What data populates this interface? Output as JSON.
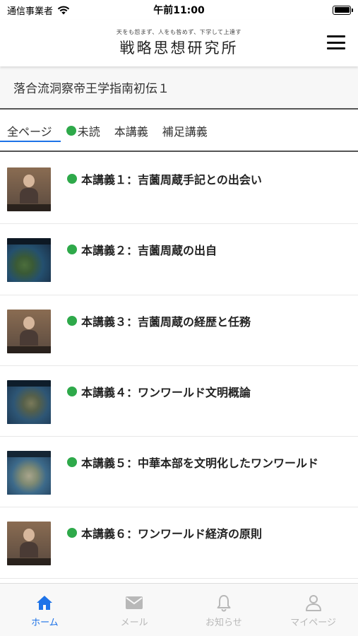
{
  "status_bar": {
    "carrier": "通信事業者",
    "time": "午前11:00"
  },
  "header": {
    "logo_tagline": "天をも怨まず、人をも咎めず、下学して上達す",
    "logo_title": "戦略思想研究所"
  },
  "course": {
    "title": "落合流洞察帝王学指南初伝１"
  },
  "tabs": [
    {
      "label": "全ページ",
      "active": true
    },
    {
      "label": "未読",
      "has_dot": true
    },
    {
      "label": "本講義"
    },
    {
      "label": "補足講義"
    }
  ],
  "lectures": [
    {
      "title": "本講義１：吉薗周蔵手記との出会い",
      "unread": true,
      "thumb": "speaker"
    },
    {
      "title": "本講義２：吉薗周蔵の出自",
      "unread": true,
      "thumb": "map"
    },
    {
      "title": "本講義３：吉薗周蔵の経歴と任務",
      "unread": true,
      "thumb": "speaker"
    },
    {
      "title": "本講義４：ワンワールド文明概論",
      "unread": true,
      "thumb": "map"
    },
    {
      "title": "本講義５：中華本部を文明化したワンワールド",
      "unread": true,
      "thumb": "map"
    },
    {
      "title": "本講義６：ワンワールド経済の原則",
      "unread": true,
      "thumb": "speaker"
    }
  ],
  "tab_bar": [
    {
      "label": "ホーム",
      "icon": "home-icon",
      "active": true
    },
    {
      "label": "メール",
      "icon": "mail-icon"
    },
    {
      "label": "お知らせ",
      "icon": "bell-icon"
    },
    {
      "label": "マイページ",
      "icon": "person-icon"
    }
  ],
  "colors": {
    "accent": "#1e73e8",
    "unread_dot": "#2ea94a",
    "inactive": "#b8b8b8"
  }
}
